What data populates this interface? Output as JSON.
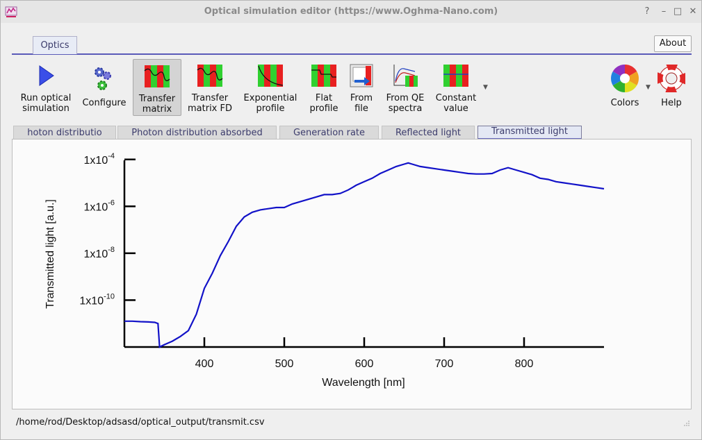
{
  "window": {
    "title": "Optical simulation editor (https://www.Oghma-Nano.com)"
  },
  "ribbon": {
    "tab_label": "Optics",
    "about_label": "About"
  },
  "toolbar": {
    "run_optical": "Run optical\nsimulation",
    "configure": "Configure",
    "transfer_matrix": "Transfer\nmatrix",
    "transfer_matrix_fd": "Transfer\nmatrix FD",
    "exponential_profile": "Exponential\nprofile",
    "flat_profile": "Flat\nprofile",
    "from_file": "From\nfile",
    "from_qe_spectra": "From QE\nspectra",
    "constant_value": "Constant\nvalue",
    "colors": "Colors",
    "help": "Help"
  },
  "subtabs": [
    {
      "label": "hoton distributio"
    },
    {
      "label": "Photon distribution absorbed"
    },
    {
      "label": "Generation rate"
    },
    {
      "label": "Reflected light"
    },
    {
      "label": "Transmitted light"
    }
  ],
  "status": {
    "path": "/home/rod/Desktop/adsasd/optical_output/transmit.csv"
  },
  "chart_data": {
    "type": "line",
    "xlabel": "Wavelength [nm]",
    "ylabel": "Transmitted light [a.u.]",
    "xlim": [
      300,
      900
    ],
    "ylim_log10": [
      -12,
      -3.8
    ],
    "yscale": "log",
    "x_ticks": [
      "400",
      "500",
      "600",
      "700",
      "800"
    ],
    "x_tick_values": [
      400,
      500,
      600,
      700,
      800
    ],
    "y_ticks": [
      {
        "base": "1x10",
        "exp": "-4",
        "log10": -4
      },
      {
        "base": "1x10",
        "exp": "-6",
        "log10": -6
      },
      {
        "base": "1x10",
        "exp": "-8",
        "log10": -8
      },
      {
        "base": "1x10",
        "exp": "-10",
        "log10": -10
      }
    ],
    "series_color": "#1212c8",
    "series": [
      {
        "x": [
          300,
          310,
          320,
          330,
          338,
          342,
          344,
          350,
          360,
          370,
          380,
          390,
          400,
          410,
          420,
          430,
          440,
          450,
          460,
          470,
          480,
          490,
          500,
          510,
          520,
          530,
          540,
          550,
          560,
          570,
          580,
          590,
          600,
          610,
          620,
          630,
          640,
          650,
          655,
          660,
          670,
          680,
          690,
          700,
          710,
          720,
          730,
          740,
          750,
          760,
          770,
          780,
          790,
          800,
          810,
          820,
          830,
          840,
          850,
          860,
          870,
          880,
          890,
          900
        ],
        "y_log10": [
          -10.9,
          -10.9,
          -10.92,
          -10.93,
          -10.95,
          -11.0,
          -12.0,
          -11.9,
          -11.75,
          -11.55,
          -11.3,
          -10.6,
          -9.5,
          -8.85,
          -8.1,
          -7.5,
          -6.85,
          -6.45,
          -6.25,
          -6.15,
          -6.1,
          -6.05,
          -6.05,
          -5.9,
          -5.8,
          -5.7,
          -5.6,
          -5.5,
          -5.5,
          -5.45,
          -5.3,
          -5.1,
          -4.95,
          -4.8,
          -4.6,
          -4.45,
          -4.3,
          -4.2,
          -4.15,
          -4.2,
          -4.3,
          -4.35,
          -4.4,
          -4.45,
          -4.5,
          -4.55,
          -4.6,
          -4.62,
          -4.62,
          -4.6,
          -4.45,
          -4.35,
          -4.45,
          -4.55,
          -4.65,
          -4.8,
          -4.85,
          -4.95,
          -5.0,
          -5.05,
          -5.1,
          -5.15,
          -5.2,
          -5.25
        ]
      }
    ]
  }
}
